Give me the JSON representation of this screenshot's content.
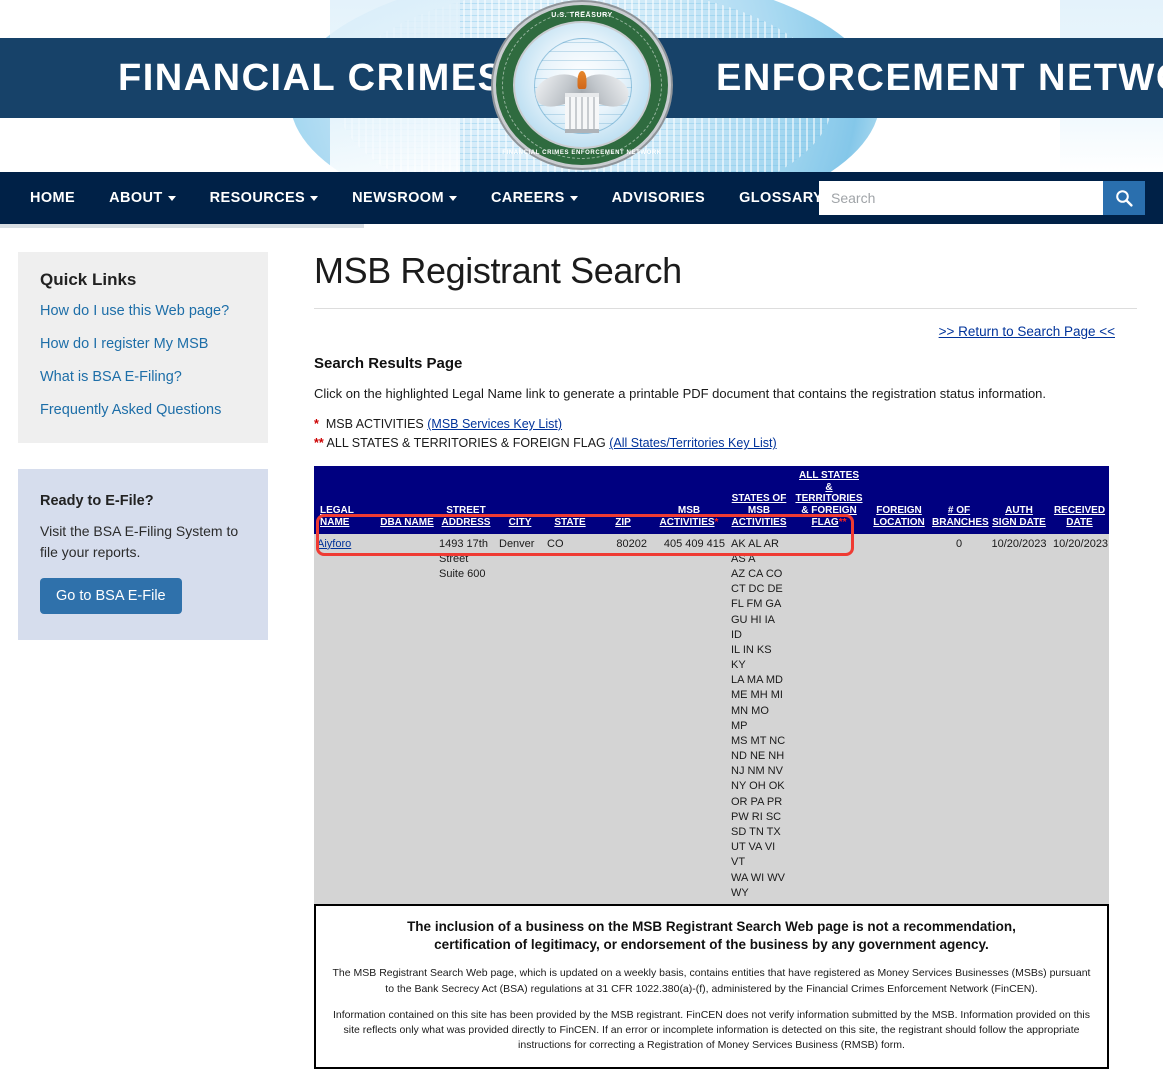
{
  "masthead": {
    "title_left": "FINANCIAL CRIMES",
    "title_right": "ENFORCEMENT NETWORK",
    "seal_top_text": "U.S. TREASURY",
    "seal_bottom_text": "FINANCIAL CRIMES ENFORCEMENT NETWORK",
    "banner_color": "#174269"
  },
  "nav": {
    "items": [
      {
        "label": "HOME",
        "has_caret": false
      },
      {
        "label": "ABOUT",
        "has_caret": true
      },
      {
        "label": "RESOURCES",
        "has_caret": true
      },
      {
        "label": "NEWSROOM",
        "has_caret": true
      },
      {
        "label": "CAREERS",
        "has_caret": true
      },
      {
        "label": "ADVISORIES",
        "has_caret": false
      },
      {
        "label": "GLOSSARY",
        "has_caret": false
      }
    ],
    "search": {
      "value": "",
      "placeholder": "Search",
      "icon": "search-icon"
    },
    "bar_color": "#002147",
    "search_button_color": "#2a6fae"
  },
  "sidebar": {
    "quick_links": {
      "title": "Quick Links",
      "items": [
        "How do I use this Web page?",
        "How do I register My MSB",
        "What is BSA E-Filing?",
        "Frequently Asked Questions"
      ]
    },
    "efile": {
      "title": "Ready to E-File?",
      "text": "Visit the BSA E-Filing System to file your reports.",
      "button_label": "Go to BSA E-File",
      "button_color": "#2f71ab"
    }
  },
  "main": {
    "page_title": "MSB Registrant Search",
    "return_link": ">> Return to Search Page <<",
    "results_heading": "Search Results Page",
    "click_note": "Click on the highlighted Legal Name link to generate a printable PDF document that contains the registration status information.",
    "key_line_1": {
      "marker": "*",
      "label": "MSB ACTIVITIES",
      "link": "(MSB Services Key List)"
    },
    "key_line_2": {
      "marker": "**",
      "label": "ALL STATES & TERRITORIES & FOREIGN FLAG",
      "link": "(All States/Territories Key List)"
    }
  },
  "results_table": {
    "header_color": "#000080",
    "row_color": "#d4d4d4",
    "highlight_color": "#ef3b33",
    "columns": [
      "LEGAL NAME",
      "DBA NAME",
      "STREET ADDRESS",
      "CITY",
      "STATE",
      "ZIP",
      "MSB ACTIVITIES*",
      "STATES OF MSB ACTIVITIES",
      "ALL STATES & TERRITORIES & FOREIGN FLAG**",
      "FOREIGN LOCATION",
      "# OF BRANCHES",
      "AUTH SIGN DATE",
      "RECEIVED DATE"
    ],
    "columns_parts": {
      "legal_name": "LEGAL NAME",
      "dba_name": "DBA NAME",
      "street_address_1": "STREET",
      "street_address_2": "ADDRESS",
      "city": "CITY",
      "state": "STATE",
      "zip": "ZIP",
      "msb_activities_1": "MSB",
      "msb_activities_2": "ACTIVITIES",
      "states_of_1": "STATES OF",
      "states_of_2": "MSB",
      "states_of_3": "ACTIVITIES",
      "all_states_1": "ALL STATES",
      "all_states_2": "&",
      "all_states_3": "TERRITORIES",
      "all_states_4": "& FOREIGN",
      "all_states_5": "FLAG",
      "foreign_location_1": "FOREIGN",
      "foreign_location_2": "LOCATION",
      "branches_1": "# OF",
      "branches_2": "BRANCHES",
      "auth_1": "AUTH",
      "auth_2": "SIGN DATE",
      "received_1": "RECEIVED",
      "received_2": "DATE"
    },
    "rows": [
      {
        "legal_name": "Aiyforo",
        "dba_name": "",
        "street_address": "1493 17th Street Suite 600",
        "city": "Denver",
        "state": "CO",
        "zip": "80202",
        "msb_activities": "405 409 415",
        "states_of_msb_activities": "AK AL AR AS A\nAZ CA CO\nCT DC DE\nFL FM GA\nGU HI IA ID\nIL IN KS KY\nLA MA MD\nME MH MI\nMN MO MP\nMS MT NC\nND NE NH\nNJ NM NV\nNY OH OK\nOR PA PR\nPW RI SC\nSD TN TX\nUT VA VI VT\nWA WI WV\nWY",
        "all_states_flag": "",
        "foreign_location": "",
        "branches": "0",
        "auth_sign_date": "10/20/2023",
        "received_date": "10/20/2023"
      }
    ]
  },
  "disclaimer": {
    "heading_line_1": "The inclusion of a business on the MSB Registrant Search Web page is not a recommendation,",
    "heading_line_2": "certification of legitimacy, or endorsement of the business by any government agency.",
    "paragraph_1": "The MSB Registrant Search Web page, which is updated on a weekly basis, contains entities that have registered as Money Services Businesses (MSBs) pursuant to the Bank Secrecy Act (BSA) regulations at 31 CFR 1022.380(a)-(f), administered by the Financial Crimes Enforcement Network (FinCEN).",
    "paragraph_2": "Information contained on this site has been provided by the MSB registrant. FinCEN does not verify information submitted by the MSB. Information provided on this site reflects only what was provided directly to FinCEN. If an error or incomplete information is detected on this site, the registrant should follow the appropriate instructions for correcting a Registration of Money Services Business (RMSB) form."
  }
}
